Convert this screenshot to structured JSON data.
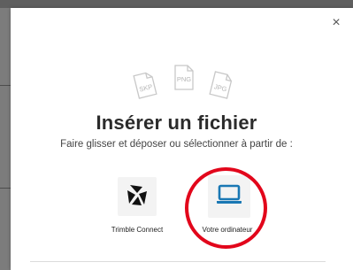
{
  "dialog": {
    "close_label": "×",
    "title": "Insérer un fichier",
    "subtitle": "Faire glisser et déposer ou sélectionner à partir de :",
    "file_types": [
      "SKP",
      "PNG",
      "JPG"
    ],
    "options": [
      {
        "label": "Trimble Connect",
        "icon": "trimble-connect-icon"
      },
      {
        "label": "Votre ordinateur",
        "icon": "laptop-icon"
      }
    ]
  },
  "colors": {
    "accent": "#1a78b4",
    "highlight": "#e2061b",
    "file_icon_gray": "#c8c8c8",
    "title": "#2b2b2b"
  }
}
